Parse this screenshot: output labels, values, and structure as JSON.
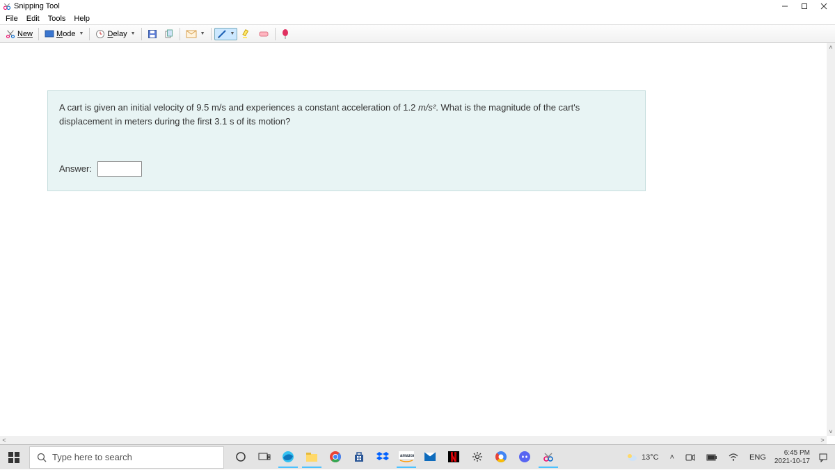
{
  "window": {
    "title": "Snipping Tool"
  },
  "menu": {
    "file": "File",
    "edit": "Edit",
    "tools": "Tools",
    "help": "Help"
  },
  "toolbar": {
    "new": "New",
    "mode": "Mode",
    "delay": "Delay"
  },
  "question": {
    "text_a": "A cart is given an initial velocity of 9.5 m/s and experiences a constant acceleration of 1.2 ",
    "unit": "m/s²",
    "text_b": ". What is the magnitude of the cart's displacement in meters during the first 3.1 s of its motion?",
    "answer_label": "Answer:",
    "answer_value": ""
  },
  "taskbar": {
    "search_placeholder": "Type here to search",
    "weather": "13°C",
    "lang": "ENG",
    "time": "6:45 PM",
    "date": "2021-10-17"
  }
}
